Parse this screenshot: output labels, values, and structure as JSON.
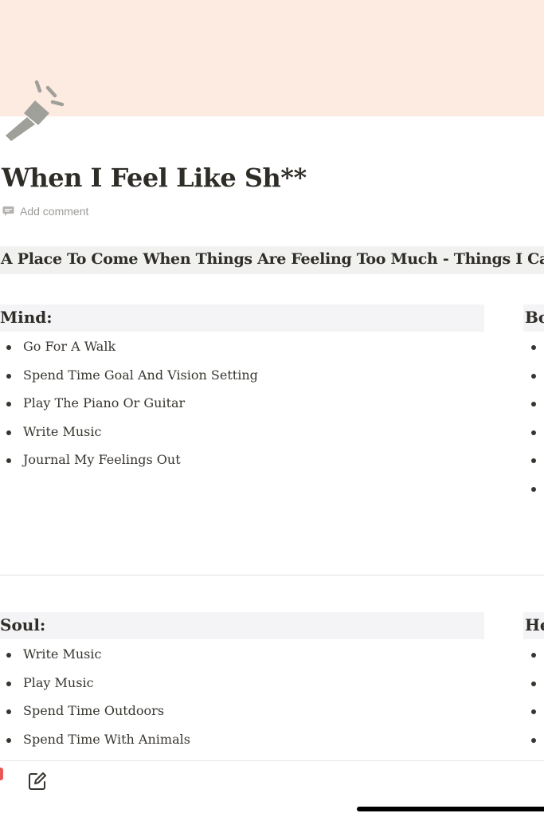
{
  "page": {
    "title": "When I Feel Like Sh**",
    "add_comment_label": "Add comment",
    "heading": "A Place To Come When Things Are Feeling Too Much - Things I Can D",
    "icon": "flashlight-icon"
  },
  "sections": {
    "mind": {
      "title": "Mind:",
      "items": [
        "Go For A Walk",
        "Spend Time Goal And Vision Setting",
        "Play The Piano Or Guitar",
        "Write Music",
        "Journal My Feelings Out"
      ]
    },
    "body": {
      "title": "Bo",
      "bullet_count": 6
    },
    "soul": {
      "title": "Soul:",
      "items": [
        "Write Music",
        "Play Music",
        "Spend Time Outdoors",
        "Spend Time With Animals"
      ]
    },
    "heart": {
      "title": "He",
      "bullet_count": 4
    }
  },
  "toolbar": {
    "edit_icon": "compose-icon"
  },
  "colors": {
    "cover": "#fdebe1",
    "heading_band": "#f1f1ef",
    "column_heading": "#f4f3f5",
    "text": "#37352f",
    "muted": "#9b9a97",
    "icon": "#a0a09a"
  }
}
